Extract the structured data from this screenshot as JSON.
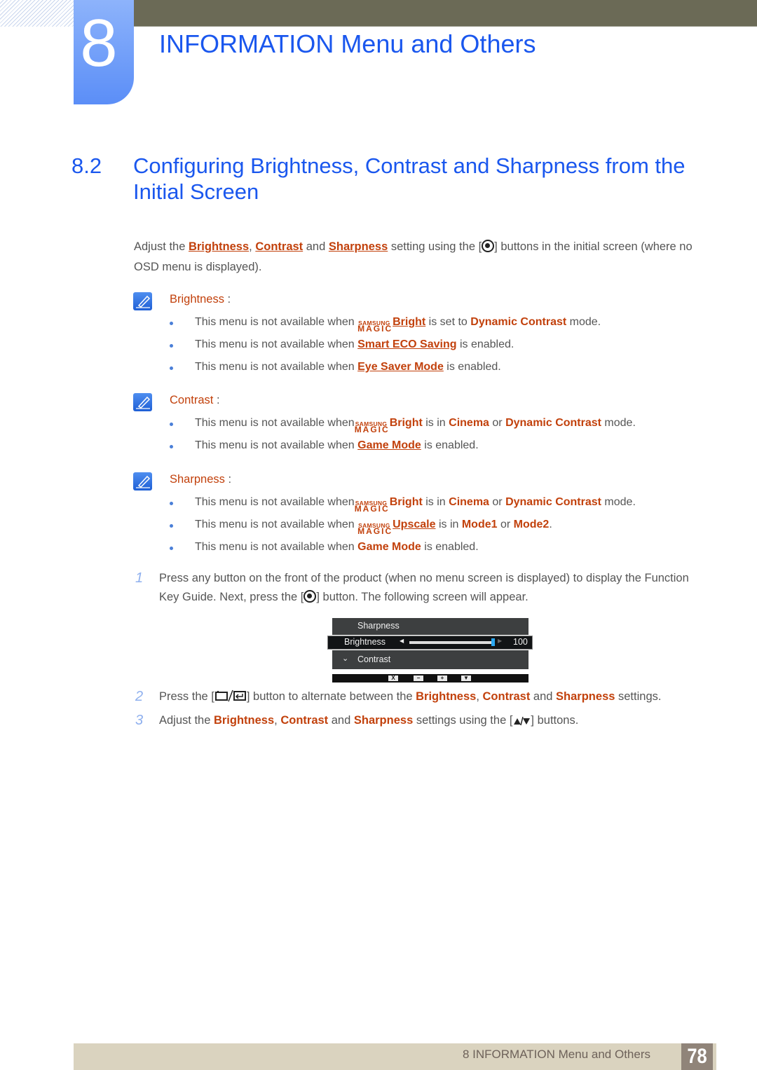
{
  "chapter": {
    "number": "8",
    "title": "INFORMATION Menu and Others"
  },
  "section": {
    "number": "8.2",
    "title": "Configuring Brightness, Contrast and Sharpness from the Initial Screen"
  },
  "intro": {
    "t1": "Adjust the ",
    "brightness": "Brightness",
    "comma": ", ",
    "contrast": "Contrast",
    "and": " and ",
    "sharpness": "Sharpness",
    "t2": " setting using the [",
    "t3": "] buttons in the initial screen (where no OSD menu is displayed)."
  },
  "magic_logo": {
    "top": "SAMSUNG",
    "bottom": "MAGIC"
  },
  "notes": [
    {
      "title": "Brightness",
      "colon": " :",
      "bullets": [
        {
          "pre": "This menu is not available when ",
          "magic": true,
          "link": "Bright",
          "mid": " is set to ",
          "ref1": "Dynamic Contrast",
          "post": " mode."
        },
        {
          "pre": "This menu is not available when ",
          "link": "Smart ECO Saving",
          "post": " is enabled."
        },
        {
          "pre": "This menu is not available when ",
          "link": "Eye Saver Mode",
          "post": " is enabled."
        }
      ]
    },
    {
      "title": "Contrast",
      "colon": " :",
      "bullets": [
        {
          "pre": "This menu is not available when",
          "magic": true,
          "ref0": "Bright",
          "mid": " is in ",
          "ref1": "Cinema",
          "or": " or ",
          "ref2": "Dynamic Contrast",
          "post": " mode."
        },
        {
          "pre": "This menu is not available when ",
          "link": "Game Mode",
          "post": " is enabled."
        }
      ]
    },
    {
      "title": "Sharpness",
      "colon": " :",
      "bullets": [
        {
          "pre": "This menu is not available when",
          "magic": true,
          "ref0": "Bright",
          "mid": " is in ",
          "ref1": "Cinema",
          "or": " or ",
          "ref2": "Dynamic Contrast",
          "post": " mode."
        },
        {
          "pre": "This menu is not available when ",
          "magic": true,
          "link": "Upscale",
          "mid": " is in ",
          "ref1": "Mode1",
          "or": " or ",
          "ref2": "Mode2",
          "post": "."
        },
        {
          "pre": "This menu is not available when ",
          "ref0": "Game Mode",
          "post": " is enabled."
        }
      ]
    }
  ],
  "steps": [
    {
      "num": "1",
      "t1": "Press any button on the front of the product (when no menu screen is displayed) to display the Function Key Guide. Next, press the [",
      "t2": "] button. The following screen will appear."
    },
    {
      "num": "2",
      "t1": "Press the [",
      "t2": "] button to alternate between the ",
      "b": "Brightness",
      "c": ", ",
      "ct": "Contrast",
      "and": " and ",
      "s": "Sharpness",
      "t3": " settings."
    },
    {
      "num": "3",
      "t1": "Adjust the ",
      "b": "Brightness",
      "c": ", ",
      "ct": "Contrast",
      "and": " and ",
      "s": "Sharpness",
      "t2": " settings using the [",
      "t3": "] buttons."
    }
  ],
  "osd": {
    "rows": [
      "Sharpness",
      "Brightness",
      "Contrast"
    ],
    "value": "100",
    "level": 100,
    "max": 100,
    "keys": [
      "X",
      "−",
      "+",
      "▼"
    ]
  },
  "footer": {
    "text": "8 INFORMATION Menu and Others",
    "page": "78"
  }
}
